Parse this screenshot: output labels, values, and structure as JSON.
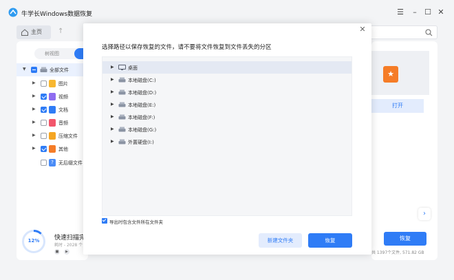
{
  "app": {
    "title": "牛学长Windows数据恢复",
    "colors": {
      "accent": "#2f7cf6",
      "logo": "#2f9bf0"
    }
  },
  "nav": {
    "home_tab": "主页",
    "search_placeholder": ""
  },
  "sidebar": {
    "view_toggle_label": "树视图",
    "root": {
      "label": "全部文件",
      "state": "partial"
    },
    "items": [
      {
        "label": "图片",
        "checked": false,
        "icon": "image-icon",
        "color": "#f7b731"
      },
      {
        "label": "视频",
        "checked": true,
        "icon": "video-icon",
        "color": "#8e6cf0"
      },
      {
        "label": "文档",
        "checked": true,
        "icon": "document-icon",
        "color": "#2f7cf6"
      },
      {
        "label": "音频",
        "checked": false,
        "icon": "audio-icon",
        "color": "#f2566b"
      },
      {
        "label": "压缩文件",
        "checked": false,
        "icon": "archive-icon",
        "color": "#f5a623"
      },
      {
        "label": "其他",
        "checked": true,
        "icon": "other-icon",
        "color": "#f57c27"
      },
      {
        "label": "无后缀文件",
        "checked": false,
        "icon": "question-icon",
        "color": "#4a8cf7"
      }
    ]
  },
  "scan": {
    "percent_label": "12%",
    "percent": 12,
    "title": "快速扫描完",
    "subtitle": "耗时 - 2028 个"
  },
  "right": {
    "open_label": "打开",
    "recover_label": "恢复",
    "footer_info": "共 1397个文件, 571.82 GB"
  },
  "dialog": {
    "title": "选择路径以保存恢复的文件，请不要将文件恢复到文件丢失的分区",
    "folders": [
      {
        "label": "桌面",
        "icon": "desktop-icon",
        "selected": true
      },
      {
        "label": "本地磁盘(C:)",
        "icon": "drive-icon",
        "selected": false
      },
      {
        "label": "本地磁盘(D:)",
        "icon": "drive-icon",
        "selected": false
      },
      {
        "label": "本地磁盘(E:)",
        "icon": "drive-icon",
        "selected": false
      },
      {
        "label": "本地磁盘(F:)",
        "icon": "drive-icon",
        "selected": false
      },
      {
        "label": "本地磁盘(G:)",
        "icon": "drive-icon",
        "selected": false
      },
      {
        "label": "外置硬盘(I:)",
        "icon": "drive-icon",
        "selected": false
      }
    ],
    "export_option": {
      "label": "导出时包含文件所在文件夹",
      "checked": true
    },
    "new_folder_label": "新建文件夹",
    "recover_label": "恢复"
  }
}
